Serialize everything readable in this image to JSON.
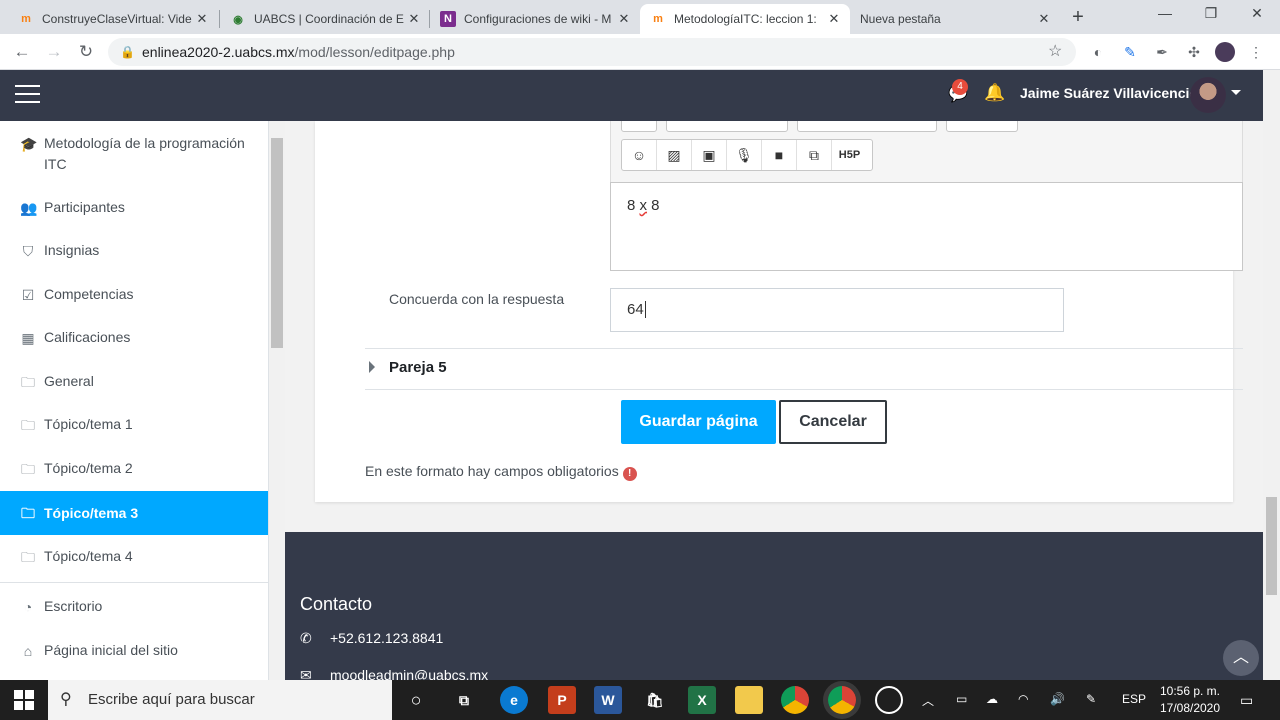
{
  "browser": {
    "tabs": [
      {
        "title": "ConstruyeClaseVirtual: Vide",
        "favicon": "moodle-icon"
      },
      {
        "title": "UABCS | Coordinación de E",
        "favicon": "uabcs-icon"
      },
      {
        "title": "Configuraciones de wiki - M",
        "favicon": "onenote-icon"
      },
      {
        "title": "MetodologíaITC: leccion 1:",
        "favicon": "moodle-icon",
        "active": true
      },
      {
        "title": "Nueva pestaña",
        "favicon": ""
      }
    ],
    "url_host": "enlinea2020-2.uabcs.mx",
    "url_path": "/mod/lesson/editpage.php"
  },
  "navbar": {
    "message_count": "4",
    "user_name": "Jaime Suárez Villavicencio"
  },
  "sidebar": {
    "items": [
      {
        "label": "Metodología de la programación",
        "label2": "ITC",
        "icon": "graduation-cap-icon"
      },
      {
        "label": "Participantes",
        "icon": "users-icon"
      },
      {
        "label": "Insignias",
        "icon": "shield-icon"
      },
      {
        "label": "Competencias",
        "icon": "check-square-icon"
      },
      {
        "label": "Calificaciones",
        "icon": "table-icon"
      },
      {
        "label": "General",
        "icon": "folder-icon"
      },
      {
        "label": "Tópico/tema 1",
        "icon": "folder-icon"
      },
      {
        "label": "Tópico/tema 2",
        "icon": "folder-icon"
      },
      {
        "label": "Tópico/tema 3",
        "icon": "folder-icon",
        "active": true
      },
      {
        "label": "Tópico/tema 4",
        "icon": "folder-icon"
      },
      {
        "label": "Escritorio",
        "icon": "dashboard-icon"
      },
      {
        "label": "Página inicial del sitio",
        "icon": "home-icon"
      }
    ]
  },
  "form": {
    "editor_text_a": "8 ",
    "editor_text_x": "x",
    "editor_text_b": " 8",
    "answer_label": "Concuerda con la respuesta",
    "answer_value": "64",
    "section_title": "Pareja 5",
    "save_label": "Guardar página",
    "cancel_label": "Cancelar",
    "required_note": "En este formato hay campos obligatorios",
    "toolbar_h5p": "H5P"
  },
  "footer": {
    "title": "Contacto",
    "phone": "+52.612.123.8841",
    "email": "moodleadmin@uabcs.mx"
  },
  "taskbar": {
    "search_placeholder": "Escribe aquí para buscar",
    "lang": "ESP",
    "time": "10:56 p. m.",
    "date": "17/08/2020"
  },
  "colors": {
    "accent": "#00a8ff",
    "navbar": "#343a4a"
  }
}
